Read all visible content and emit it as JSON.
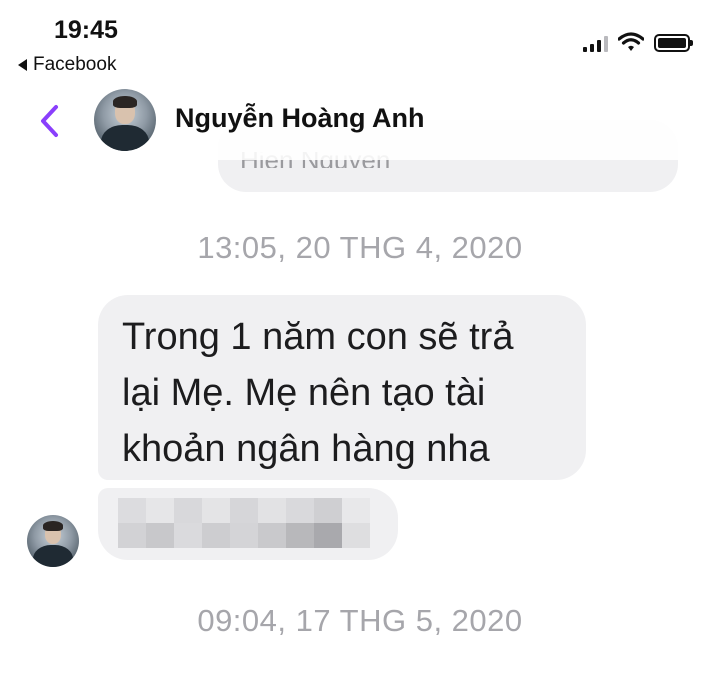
{
  "status_bar": {
    "time": "19:45",
    "back_app": "Facebook",
    "icons": [
      "signal-icon",
      "wifi-icon",
      "battery-icon"
    ]
  },
  "header": {
    "back_icon": "chevron-left-icon",
    "contact_name": "Nguyễn Hoàng Anh",
    "accent_color": "#8a3ffc"
  },
  "conversation": {
    "previous_message_partial": "Hien Nguyen",
    "timestamp_1": "13:05, 20 THG 4, 2020",
    "message_lines": [
      "Trong 1 năm con sẽ trả",
      "lại Mẹ. Mẹ nên tạo tài",
      "khoản ngân hàng nha"
    ],
    "redacted_message": "blurred-content",
    "timestamp_2": "09:04, 17 THG 5, 2020"
  },
  "colors": {
    "bubble": "#f0f0f2",
    "timestamp": "#a6a6ab"
  }
}
